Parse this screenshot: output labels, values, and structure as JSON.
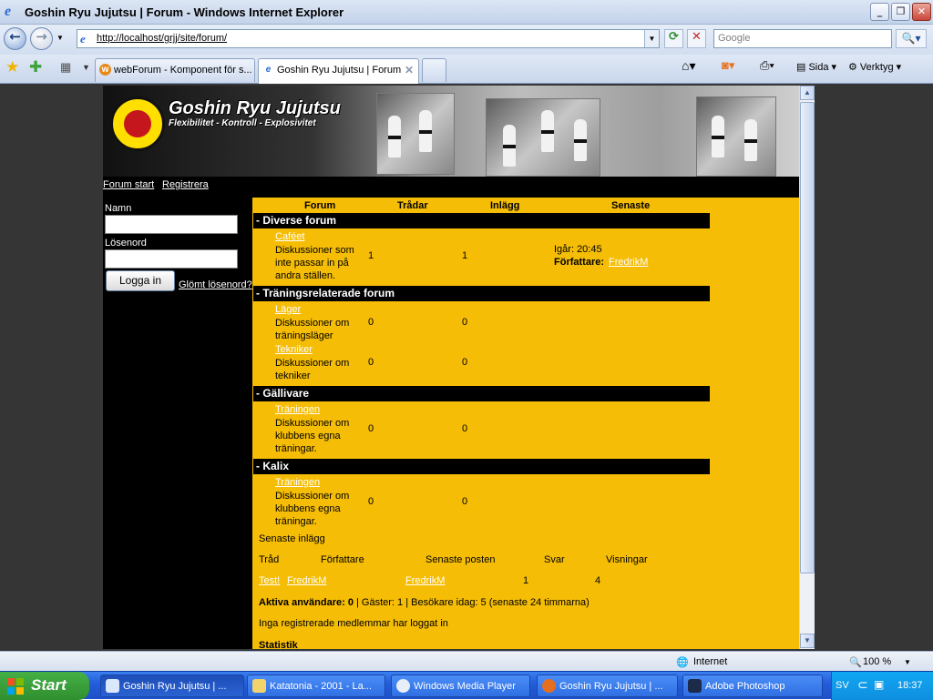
{
  "window": {
    "title": "Goshin Ryu Jujutsu | Forum - Windows Internet Explorer"
  },
  "address": {
    "url": "http://localhost/grjj/site/forum/",
    "search_placeholder": "Google"
  },
  "tabs": [
    {
      "label": "webForum - Komponent för s..."
    },
    {
      "label": "Goshin Ryu Jujutsu | Forum"
    }
  ],
  "commandbar": {
    "page": "Sida",
    "tools": "Verktyg"
  },
  "banner": {
    "brand": "Goshin Ryu Jujutsu",
    "tagline": "Flexibilitet - Kontroll - Explosivitet"
  },
  "site_nav": {
    "forum_start": "Forum start",
    "register": "Registrera"
  },
  "login": {
    "name_label": "Namn",
    "password_label": "Lösenord",
    "login_button": "Logga in",
    "forgot": "Glömt lösenord?"
  },
  "forum_table": {
    "headers": {
      "forum": "Forum",
      "threads": "Trådar",
      "posts": "Inlägg",
      "latest": "Senaste"
    },
    "categories": [
      {
        "name": "- Diverse forum",
        "forums": [
          {
            "link": "Caféet",
            "desc": "Diskussioner som inte passar in på andra ställen.",
            "threads": "1",
            "posts": "1",
            "latest_time": "Igår: 20:45",
            "latest_author_label": "Författare:",
            "latest_author": "FredrikM"
          }
        ]
      },
      {
        "name": "- Träningsrelaterade forum",
        "forums": [
          {
            "link": "Läger",
            "desc": "Diskussioner om träningsläger",
            "threads": "0",
            "posts": "0"
          },
          {
            "link": "Tekniker",
            "desc": "Diskussioner om tekniker",
            "threads": "0",
            "posts": "0"
          }
        ]
      },
      {
        "name": "- Gällivare",
        "forums": [
          {
            "link": "Träningen",
            "desc": "Diskussioner om klubbens egna träningar.",
            "threads": "0",
            "posts": "0"
          }
        ]
      },
      {
        "name": "- Kalix",
        "forums": [
          {
            "link": "Träningen",
            "desc": "Diskussioner om klubbens egna träningar.",
            "threads": "0",
            "posts": "0"
          }
        ]
      }
    ]
  },
  "latest_posts": {
    "title": "Senaste inlägg",
    "headers": [
      "Tråd",
      "Författare",
      "Senaste posten",
      "Svar",
      "Visningar"
    ],
    "rows": [
      {
        "thread": "Test!",
        "author": "FredrikM",
        "last_post": "FredrikM",
        "replies": "1",
        "views": "4"
      }
    ]
  },
  "active_users": {
    "label": "Aktiva användare: 0",
    "rest": " | Gäster: 1 | Besökare idag: 5 (senaste 24 timmarna)",
    "none_logged": "Inga registrerade medlemmar har loggat in",
    "stats": "Statistik"
  },
  "statusbar": {
    "zone": "Internet",
    "zoom": "100 %"
  },
  "taskbar": {
    "start": "Start",
    "items": [
      "Goshin Ryu Jujutsu | ...",
      "Katatonia - 2001 - La...",
      "Windows Media Player",
      "Goshin Ryu Jujutsu | ...",
      "Adobe Photoshop"
    ],
    "lang": "SV",
    "clock": "18:37"
  },
  "colors": {
    "forum_bg": "#f5bd05",
    "page_bg": "#353535",
    "header_black": "#000000"
  }
}
